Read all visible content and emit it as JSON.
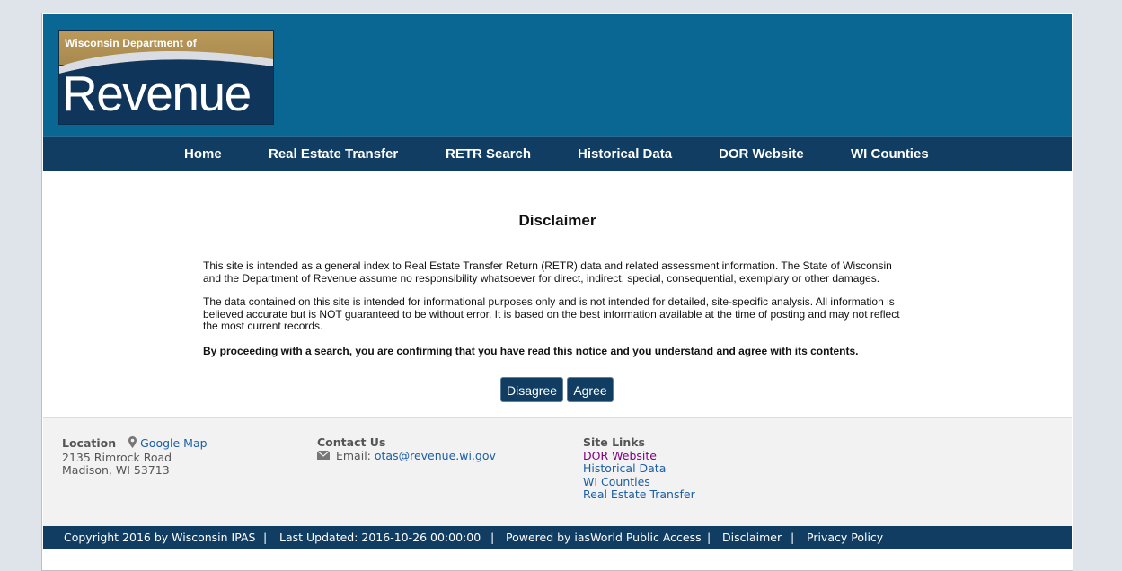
{
  "logo": {
    "line1": "Wisconsin Department of",
    "line2": "Revenue"
  },
  "nav": {
    "home": "Home",
    "real_estate_transfer": "Real Estate Transfer",
    "retr_search": "RETR Search",
    "historical_data": "Historical Data",
    "dor_website": "DOR Website",
    "wi_counties": "WI Counties"
  },
  "main": {
    "title": "Disclaimer",
    "para1": "This site is intended as a general index to Real Estate Transfer Return (RETR) data and related assessment information. The State of Wisconsin and the Department of Revenue assume no responsibility whatsoever for direct, indirect, special, consequential, exemplary or other damages.",
    "para2": "The data contained on this site is intended for informational purposes only and is not intended for detailed, site-specific analysis. All information is believed accurate but is NOT guaranteed to be without error. It is based on the best information available at the time of posting and may not reflect the most current records.",
    "para3": "By proceeding with a search, you are confirming that you have read this notice and you understand and agree with its contents.",
    "disagree_label": "Disagree",
    "agree_label": "Agree"
  },
  "footer": {
    "location": {
      "heading": "Location",
      "map_link": "Google Map",
      "address1": "2135 Rimrock Road",
      "address2": "Madison, WI 53713"
    },
    "contact": {
      "heading": "Contact Us",
      "email_label": "Email:",
      "email": "otas@revenue.wi.gov"
    },
    "site_links": {
      "heading": "Site Links",
      "links": [
        "DOR Website",
        "Historical Data",
        "WI Counties",
        "Real Estate Transfer"
      ]
    }
  },
  "bottom": {
    "copyright": "Copyright 2016 by Wisconsin IPAS",
    "last_updated": "Last Updated: 2016-10-26 00:00:00",
    "powered": "Powered by iasWorld Public Access",
    "disclaimer": "Disclaimer",
    "privacy": "Privacy Policy",
    "separator": "|"
  },
  "colors": {
    "header": "#0a6793",
    "nav": "#103d61",
    "link": "#1c5fa6",
    "visited_link": "#800080"
  },
  "icons": {
    "map_marker": "map-marker-icon",
    "envelope": "envelope-icon"
  }
}
